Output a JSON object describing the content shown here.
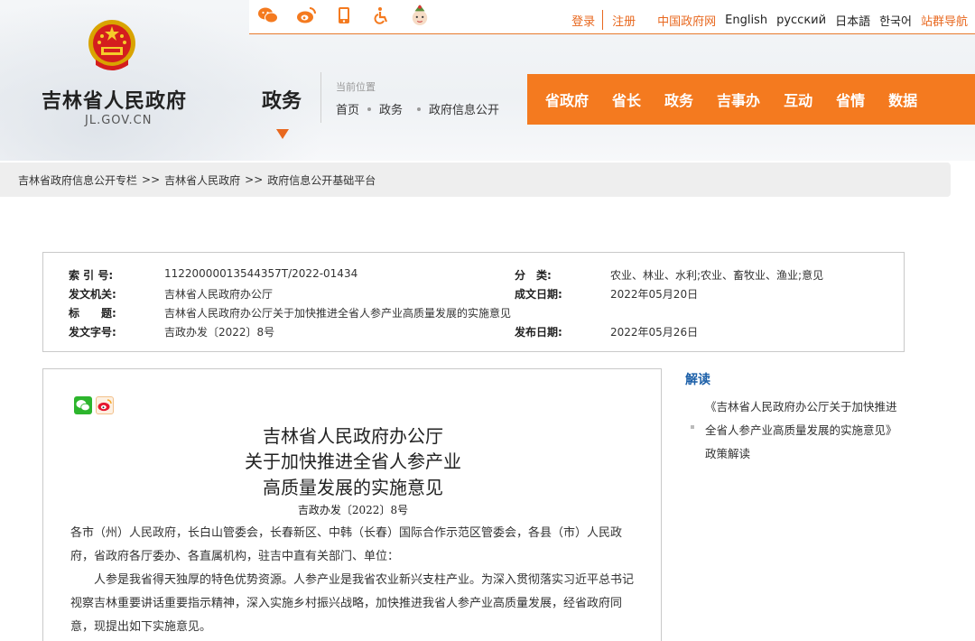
{
  "top_bar": {
    "icons": [
      "wechat-icon",
      "weibo-icon",
      "mobile-icon",
      "accessibility-icon",
      "elder-mode-icon"
    ],
    "login": "登录",
    "register": "注册",
    "links": [
      "中国政府网",
      "English",
      "русский",
      "日本語",
      "한국어",
      "站群导航"
    ]
  },
  "site": {
    "name": "吉林省人民政府",
    "domain": "JL.GOV.CN"
  },
  "section": {
    "title": "政务",
    "location_label": "当前位置",
    "location_path": [
      "首页",
      "政务",
      "政府信息公开"
    ]
  },
  "main_nav": [
    "省政府",
    "省长",
    "政务",
    "吉事办",
    "互动",
    "省情",
    "数据"
  ],
  "breadcrumb": [
    "吉林省政府信息公开专栏",
    "吉林省人民政府",
    "政府信息公开基础平台"
  ],
  "breadcrumb_sep": ">>",
  "meta": {
    "index_label": "索 引 号:",
    "index_value": "11220000013544357T/2022-01434",
    "category_label": "分　类:",
    "category_value": "农业、林业、水利;农业、畜牧业、渔业;意见",
    "issuer_label": "发文机关:",
    "issuer_value": "吉林省人民政府办公厅",
    "date_written_label": "成文日期:",
    "date_written_value": "2022年05月20日",
    "title_label": "标　　题:",
    "title_value": "吉林省人民政府办公厅关于加快推进全省人参产业高质量发展的实施意见",
    "doc_no_label": "发文字号:",
    "doc_no_value": "吉政办发〔2022〕8号",
    "publish_date_label": "发布日期:",
    "publish_date_value": "2022年05月26日"
  },
  "article": {
    "title_lines": [
      "吉林省人民政府办公厅",
      "关于加快推进全省人参产业",
      "高质量发展的实施意见"
    ],
    "doc_no": "吉政办发〔2022〕8号",
    "recipients": "各市（州）人民政府，长白山管委会，长春新区、中韩（长春）国际合作示范区管委会，各县（市）人民政府，省政府各厅委办、各直属机构，驻吉中直有关部门、单位：",
    "body": "　　人参是我省得天独厚的特色优势资源。人参产业是我省农业新兴支柱产业。为深入贯彻落实习近平总书记视察吉林重要讲话重要指示精神，深入实施乡村振兴战略，加快推进我省人参产业高质量发展，经省政府同意，现提出如下实施意见。"
  },
  "sidebar": {
    "title": "解读",
    "link": "《吉林省人民政府办公厅关于加快推进全省人参产业高质量发展的实施意见》政策解读"
  },
  "colors": {
    "accent": "#f47a1f",
    "link_orange": "#e8681f",
    "sidebar_blue": "#1b5fa8"
  }
}
